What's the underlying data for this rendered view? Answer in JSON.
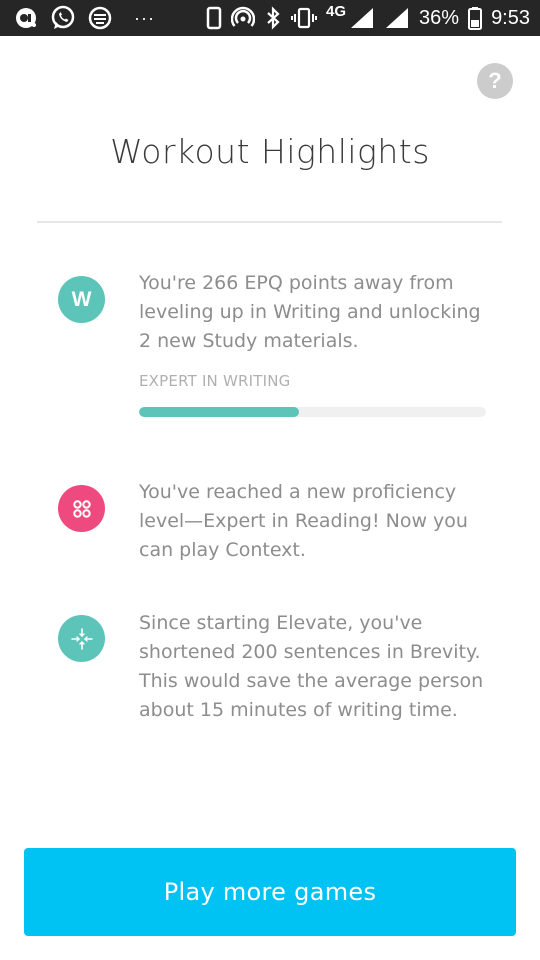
{
  "status_bar": {
    "network": "4G",
    "battery": "36%",
    "time": "9:53",
    "icons": [
      "notification-icon",
      "whatsapp-icon",
      "app-icon",
      "phone-icon",
      "hotspot-icon",
      "bluetooth-icon",
      "vibrate-icon",
      "signal-icon",
      "battery-icon"
    ],
    "more": "···"
  },
  "help": {
    "label": "?"
  },
  "title": "Workout Highlights",
  "highlights": [
    {
      "icon": "W",
      "icon_color": "#5cc4b8",
      "text": "You're 266 EPQ points away from leveling up in Writing and unlocking 2 new Study materials.",
      "progress_label": "EXPERT IN WRITING",
      "progress_fraction": 0.46
    },
    {
      "icon": "dots-icon",
      "icon_color": "#ee4a7f",
      "text": "You've reached a new proficiency level—Expert in Reading! Now you can play Context."
    },
    {
      "icon": "brevity-icon",
      "icon_color": "#5cc4b8",
      "text": "Since starting Elevate, you've shortened 200 sentences in Brevity. This would save the average person about 15 minutes of writing time."
    }
  ],
  "cta": {
    "label": "Play more games",
    "color": "#00c2f3"
  }
}
